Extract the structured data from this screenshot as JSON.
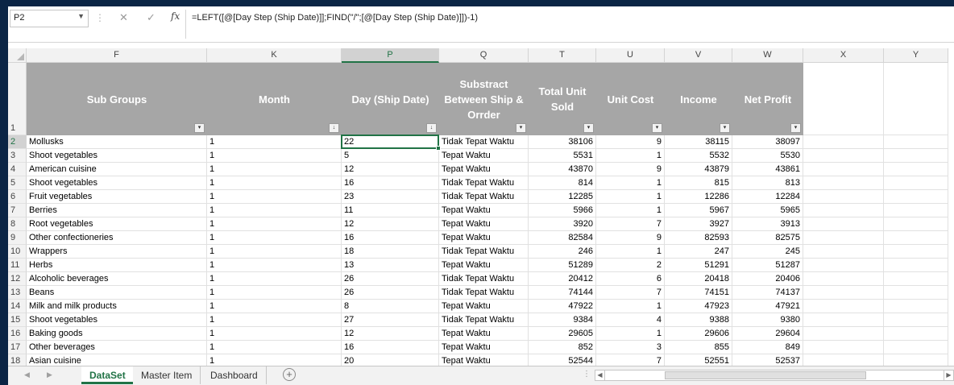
{
  "formula_bar": {
    "name_box": "P2",
    "cancel_glyph": "✕",
    "enter_glyph": "✓",
    "fx_label": "fx",
    "formula": "=LEFT([@[Day Step (Ship Date)]];FIND(\"/\";[@[Day Step (Ship Date)]])-1)"
  },
  "columns": [
    "F",
    "K",
    "P",
    "Q",
    "T",
    "U",
    "V",
    "W",
    "X",
    "Y"
  ],
  "active_column": "P",
  "header_row_number": "1",
  "table_headers": [
    {
      "label": "Sub Groups",
      "filter": "▾"
    },
    {
      "label": "Month",
      "filter": "↓"
    },
    {
      "label": "Day (Ship Date)",
      "filter": "↓"
    },
    {
      "label": "Substract Between Ship & Orrder",
      "filter": "▾"
    },
    {
      "label": "Total Unit Sold",
      "filter": "▾"
    },
    {
      "label": "Unit Cost",
      "filter": "▾"
    },
    {
      "label": "Income",
      "filter": "▾"
    },
    {
      "label": "Net Profit",
      "filter": "▾"
    }
  ],
  "rows": [
    {
      "num": "2",
      "sub_group": "Mollusks",
      "month": "1",
      "day": "22",
      "status": "Tidak Tepat Waktu",
      "total_unit_sold": "38106",
      "unit_cost": "9",
      "income": "38115",
      "net_profit": "38097"
    },
    {
      "num": "3",
      "sub_group": "Shoot vegetables",
      "month": "1",
      "day": "5",
      "status": "Tepat Waktu",
      "total_unit_sold": "5531",
      "unit_cost": "1",
      "income": "5532",
      "net_profit": "5530"
    },
    {
      "num": "4",
      "sub_group": "American cuisine",
      "month": "1",
      "day": "12",
      "status": "Tepat Waktu",
      "total_unit_sold": "43870",
      "unit_cost": "9",
      "income": "43879",
      "net_profit": "43861"
    },
    {
      "num": "5",
      "sub_group": "Shoot vegetables",
      "month": "1",
      "day": "16",
      "status": "Tidak Tepat Waktu",
      "total_unit_sold": "814",
      "unit_cost": "1",
      "income": "815",
      "net_profit": "813"
    },
    {
      "num": "6",
      "sub_group": "Fruit vegetables",
      "month": "1",
      "day": "23",
      "status": "Tidak Tepat Waktu",
      "total_unit_sold": "12285",
      "unit_cost": "1",
      "income": "12286",
      "net_profit": "12284"
    },
    {
      "num": "7",
      "sub_group": "Berries",
      "month": "1",
      "day": "11",
      "status": "Tepat Waktu",
      "total_unit_sold": "5966",
      "unit_cost": "1",
      "income": "5967",
      "net_profit": "5965"
    },
    {
      "num": "8",
      "sub_group": "Root vegetables",
      "month": "1",
      "day": "12",
      "status": "Tepat Waktu",
      "total_unit_sold": "3920",
      "unit_cost": "7",
      "income": "3927",
      "net_profit": "3913"
    },
    {
      "num": "9",
      "sub_group": "Other confectioneries",
      "month": "1",
      "day": "16",
      "status": "Tepat Waktu",
      "total_unit_sold": "82584",
      "unit_cost": "9",
      "income": "82593",
      "net_profit": "82575"
    },
    {
      "num": "10",
      "sub_group": "Wrappers",
      "month": "1",
      "day": "18",
      "status": "Tidak Tepat Waktu",
      "total_unit_sold": "246",
      "unit_cost": "1",
      "income": "247",
      "net_profit": "245"
    },
    {
      "num": "11",
      "sub_group": "Herbs",
      "month": "1",
      "day": "13",
      "status": "Tepat Waktu",
      "total_unit_sold": "51289",
      "unit_cost": "2",
      "income": "51291",
      "net_profit": "51287"
    },
    {
      "num": "12",
      "sub_group": "Alcoholic beverages",
      "month": "1",
      "day": "26",
      "status": "Tidak Tepat Waktu",
      "total_unit_sold": "20412",
      "unit_cost": "6",
      "income": "20418",
      "net_profit": "20406"
    },
    {
      "num": "13",
      "sub_group": "Beans",
      "month": "1",
      "day": "26",
      "status": "Tidak Tepat Waktu",
      "total_unit_sold": "74144",
      "unit_cost": "7",
      "income": "74151",
      "net_profit": "74137"
    },
    {
      "num": "14",
      "sub_group": "Milk and milk products",
      "month": "1",
      "day": "8",
      "status": "Tepat Waktu",
      "total_unit_sold": "47922",
      "unit_cost": "1",
      "income": "47923",
      "net_profit": "47921"
    },
    {
      "num": "15",
      "sub_group": "Shoot vegetables",
      "month": "1",
      "day": "27",
      "status": "Tidak Tepat Waktu",
      "total_unit_sold": "9384",
      "unit_cost": "4",
      "income": "9388",
      "net_profit": "9380"
    },
    {
      "num": "16",
      "sub_group": "Baking goods",
      "month": "1",
      "day": "12",
      "status": "Tepat Waktu",
      "total_unit_sold": "29605",
      "unit_cost": "1",
      "income": "29606",
      "net_profit": "29604"
    },
    {
      "num": "17",
      "sub_group": "Other beverages",
      "month": "1",
      "day": "16",
      "status": "Tepat Waktu",
      "total_unit_sold": "852",
      "unit_cost": "3",
      "income": "855",
      "net_profit": "849"
    },
    {
      "num": "18",
      "sub_group": "Asian cuisine",
      "month": "1",
      "day": "20",
      "status": "Tepat Waktu",
      "total_unit_sold": "52544",
      "unit_cost": "7",
      "income": "52551",
      "net_profit": "52537"
    }
  ],
  "sheet_tabs": [
    {
      "label": "DataSet",
      "active": true
    },
    {
      "label": "Master Item",
      "active": false
    },
    {
      "label": "Dashboard",
      "active": false
    }
  ],
  "add_sheet_glyph": "+",
  "colors": {
    "accent": "#217346",
    "table_header_bg": "#a6a6a6",
    "backdrop": "#0b2545"
  }
}
